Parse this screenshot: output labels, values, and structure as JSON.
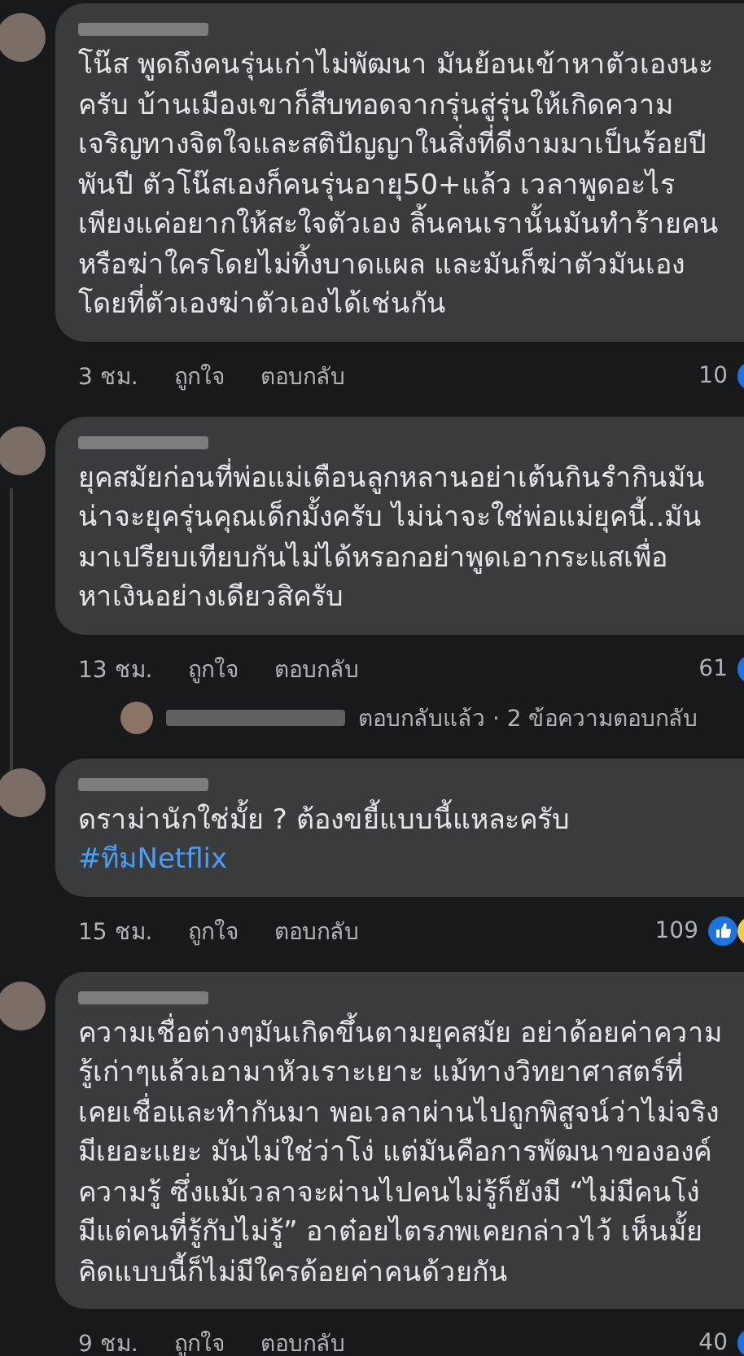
{
  "comments": [
    {
      "text": "โน๊ส พูดถึงคนรุ่นเก่าไม่พัฒนา มันย้อนเข้าหาตัวเองนะครับ บ้านเมืองเขาก็สืบทอดจากรุ่นสู่รุ่นให้เกิดความเจริญทางจิตใจและสติปัญญาในสิ่งที่ดีงามมาเป็นร้อยปีพันปี  ตัวโน๊สเองก็คนรุ่นอายุ50+แล้ว เวลาพูดอะไร เพียงแค่อยากให้สะใจตัวเอง ลิ้นคนเรานั้นมันทำร้ายคนหรือฆ่าใครโดยไม่ทิ้งบาดแผล และมันก็ฆ่าตัวมันเองโดยที่ตัวเองฆ่าตัวเองได้เช่นกัน",
      "time": "3 ชม.",
      "like": "ถูกใจ",
      "reply": "ตอบกลับ",
      "count": "10",
      "reactions": [
        {
          "kind": "like"
        }
      ]
    },
    {
      "text": "ยุคสมัยก่อนที่พ่อแม่เตือนลูกหลานอย่าเต้นกินรำกินมันน่าจะยุครุ่นคุณเด็กมั้งครับ ไม่น่าจะใช่พ่อแม่ยุคนี้..มันมาเปรียบเทียบกันไม่ได้หรอกอย่าพูดเอากระแสเพื่อหาเงินอย่างเดียวสิครับ",
      "time": "13 ชม.",
      "like": "ถูกใจ",
      "reply": "ตอบกลับ",
      "count": "61",
      "reactions": [
        {
          "kind": "like"
        }
      ],
      "replies_summary": "ตอบกลับแล้ว · 2 ข้อความตอบกลับ"
    },
    {
      "text": "ดราม่านักใช่มั้ย ? ต้องขยี้แบบนี้แหละครับ",
      "hashtag": "#ทีมNetflix",
      "time": "15 ชม.",
      "like": "ถูกใจ",
      "reply": "ตอบกลับ",
      "count": "109",
      "reactions": [
        {
          "kind": "like"
        },
        {
          "kind": "haha"
        }
      ]
    },
    {
      "text": "ความเชื่อต่างๆมันเกิดขึ้นตามยุคสมัย  อย่าด้อยค่าความรู้เก่าๆแล้วเอามาหัวเราะเยาะ  แม้ทางวิทยาศาสตร์ที่เคยเชื่อและทำกันมา พอเวลาผ่านไปถูกพิสูจน์ว่าไม่จริงมีเยอะแยะ  มันไม่ใช่ว่าโง่  แต่มันคือการพัฒนาขององค์ความรู้ ซึ่งแม้เวลาจะผ่านไปคนไม่รู้ก็ยังมี  “ไม่มีคนโง่  มีแต่คนที่รู้กับไม่รู้” อาต๋อยไตรภพเคยกล่าวไว้ เห็นมั้ย คิดแบบนี้ก็ไม่มีใครด้อยค่าคนด้วยกัน",
      "time": "9 ชม.",
      "like": "ถูกใจ",
      "reply": "ตอบกลับ",
      "count": "40",
      "reactions": [
        {
          "kind": "like"
        }
      ]
    }
  ]
}
